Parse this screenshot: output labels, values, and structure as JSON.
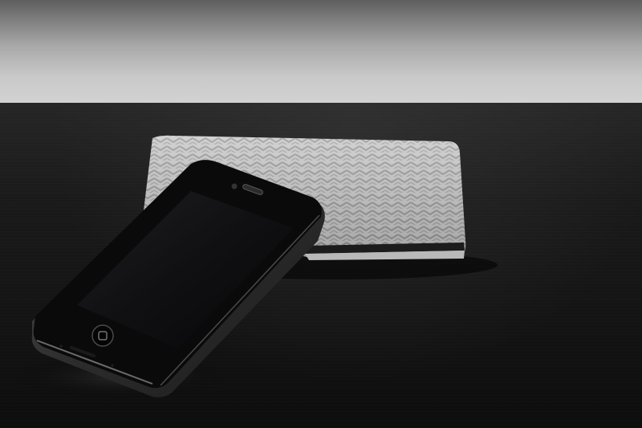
{
  "scene": {
    "description_colors": {
      "wall_light": "#d2d2d2",
      "table_dark": "#141414",
      "sleeve_fabric": "#c8c8c8",
      "sleeve_stripe": "#1c1c1c",
      "phone_body": "#0b0b0b",
      "phone_bezel": "#3a3a3a"
    },
    "objects": [
      "phone",
      "fabric-sleeve",
      "table",
      "wall"
    ]
  }
}
